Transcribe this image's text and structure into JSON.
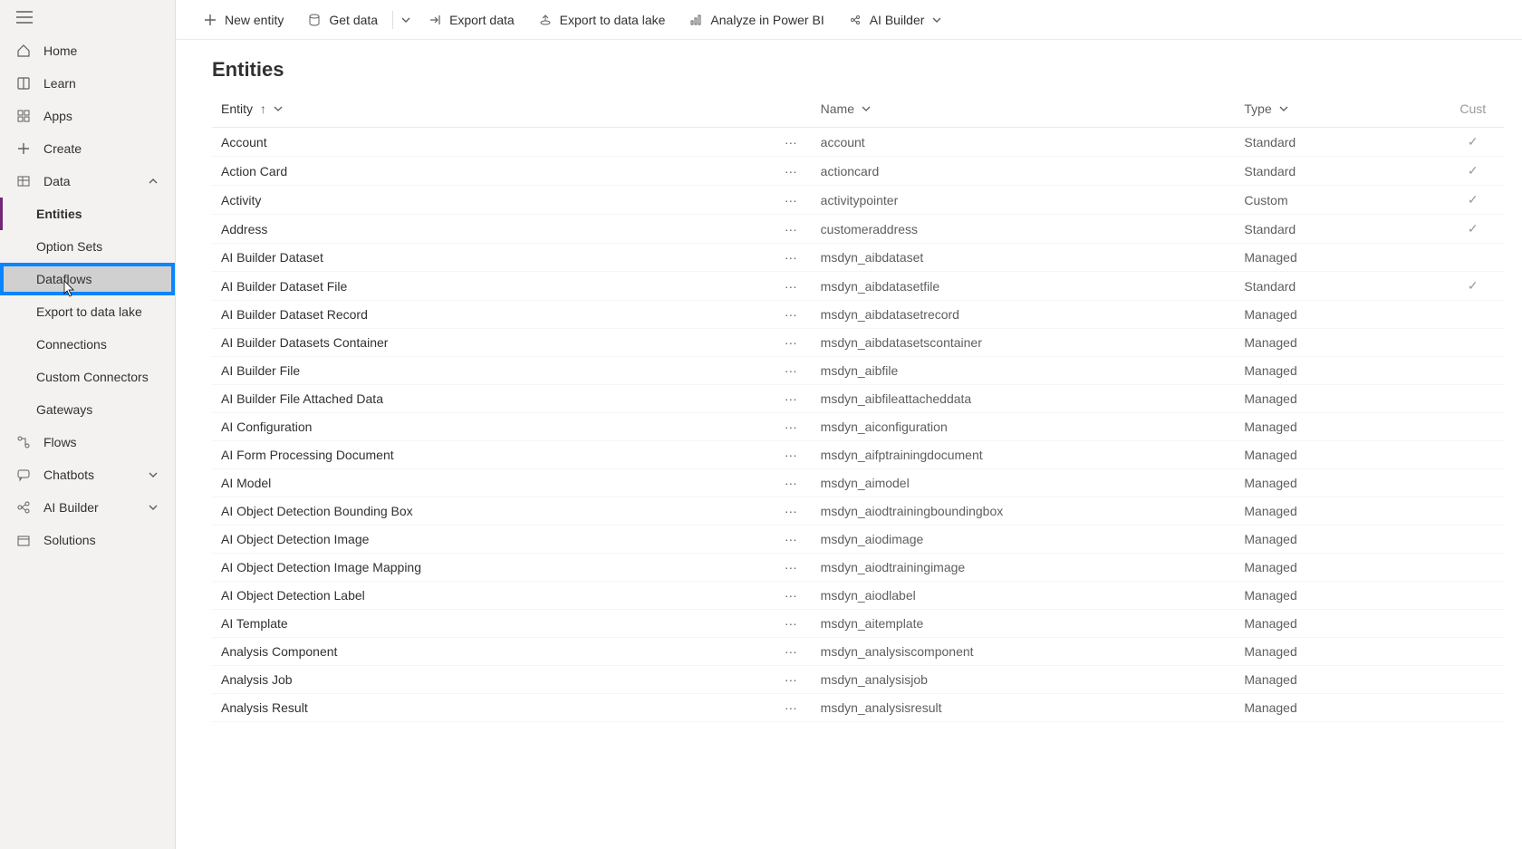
{
  "sidebar": {
    "items": [
      {
        "label": "Home",
        "icon": "home"
      },
      {
        "label": "Learn",
        "icon": "book"
      },
      {
        "label": "Apps",
        "icon": "apps"
      },
      {
        "label": "Create",
        "icon": "plus"
      },
      {
        "label": "Data",
        "icon": "table",
        "expanded": true
      },
      {
        "label": "Flows",
        "icon": "flow"
      },
      {
        "label": "Chatbots",
        "icon": "chat",
        "chevron": true
      },
      {
        "label": "AI Builder",
        "icon": "ai",
        "chevron": true
      },
      {
        "label": "Solutions",
        "icon": "package"
      }
    ],
    "data_children": [
      {
        "label": "Entities",
        "active": true
      },
      {
        "label": "Option Sets"
      },
      {
        "label": "Dataflows",
        "highlighted": true
      },
      {
        "label": "Export to data lake"
      },
      {
        "label": "Connections"
      },
      {
        "label": "Custom Connectors"
      },
      {
        "label": "Gateways"
      }
    ]
  },
  "commandbar": {
    "new_entity": "New entity",
    "get_data": "Get data",
    "export_data": "Export data",
    "export_lake": "Export to data lake",
    "analyze": "Analyze in Power BI",
    "ai_builder": "AI Builder"
  },
  "page": {
    "title": "Entities"
  },
  "table": {
    "headers": {
      "entity": "Entity",
      "name": "Name",
      "type": "Type",
      "cust": "Cust"
    },
    "rows": [
      {
        "entity": "Account",
        "name": "account",
        "type": "Standard",
        "check": true
      },
      {
        "entity": "Action Card",
        "name": "actioncard",
        "type": "Standard",
        "check": true
      },
      {
        "entity": "Activity",
        "name": "activitypointer",
        "type": "Custom",
        "check": true
      },
      {
        "entity": "Address",
        "name": "customeraddress",
        "type": "Standard",
        "check": true
      },
      {
        "entity": "AI Builder Dataset",
        "name": "msdyn_aibdataset",
        "type": "Managed",
        "check": false
      },
      {
        "entity": "AI Builder Dataset File",
        "name": "msdyn_aibdatasetfile",
        "type": "Standard",
        "check": true
      },
      {
        "entity": "AI Builder Dataset Record",
        "name": "msdyn_aibdatasetrecord",
        "type": "Managed",
        "check": false
      },
      {
        "entity": "AI Builder Datasets Container",
        "name": "msdyn_aibdatasetscontainer",
        "type": "Managed",
        "check": false
      },
      {
        "entity": "AI Builder File",
        "name": "msdyn_aibfile",
        "type": "Managed",
        "check": false
      },
      {
        "entity": "AI Builder File Attached Data",
        "name": "msdyn_aibfileattacheddata",
        "type": "Managed",
        "check": false
      },
      {
        "entity": "AI Configuration",
        "name": "msdyn_aiconfiguration",
        "type": "Managed",
        "check": false
      },
      {
        "entity": "AI Form Processing Document",
        "name": "msdyn_aifptrainingdocument",
        "type": "Managed",
        "check": false
      },
      {
        "entity": "AI Model",
        "name": "msdyn_aimodel",
        "type": "Managed",
        "check": false
      },
      {
        "entity": "AI Object Detection Bounding Box",
        "name": "msdyn_aiodtrainingboundingbox",
        "type": "Managed",
        "check": false
      },
      {
        "entity": "AI Object Detection Image",
        "name": "msdyn_aiodimage",
        "type": "Managed",
        "check": false
      },
      {
        "entity": "AI Object Detection Image Mapping",
        "name": "msdyn_aiodtrainingimage",
        "type": "Managed",
        "check": false
      },
      {
        "entity": "AI Object Detection Label",
        "name": "msdyn_aiodlabel",
        "type": "Managed",
        "check": false
      },
      {
        "entity": "AI Template",
        "name": "msdyn_aitemplate",
        "type": "Managed",
        "check": false
      },
      {
        "entity": "Analysis Component",
        "name": "msdyn_analysiscomponent",
        "type": "Managed",
        "check": false
      },
      {
        "entity": "Analysis Job",
        "name": "msdyn_analysisjob",
        "type": "Managed",
        "check": false
      },
      {
        "entity": "Analysis Result",
        "name": "msdyn_analysisresult",
        "type": "Managed",
        "check": false
      }
    ]
  }
}
